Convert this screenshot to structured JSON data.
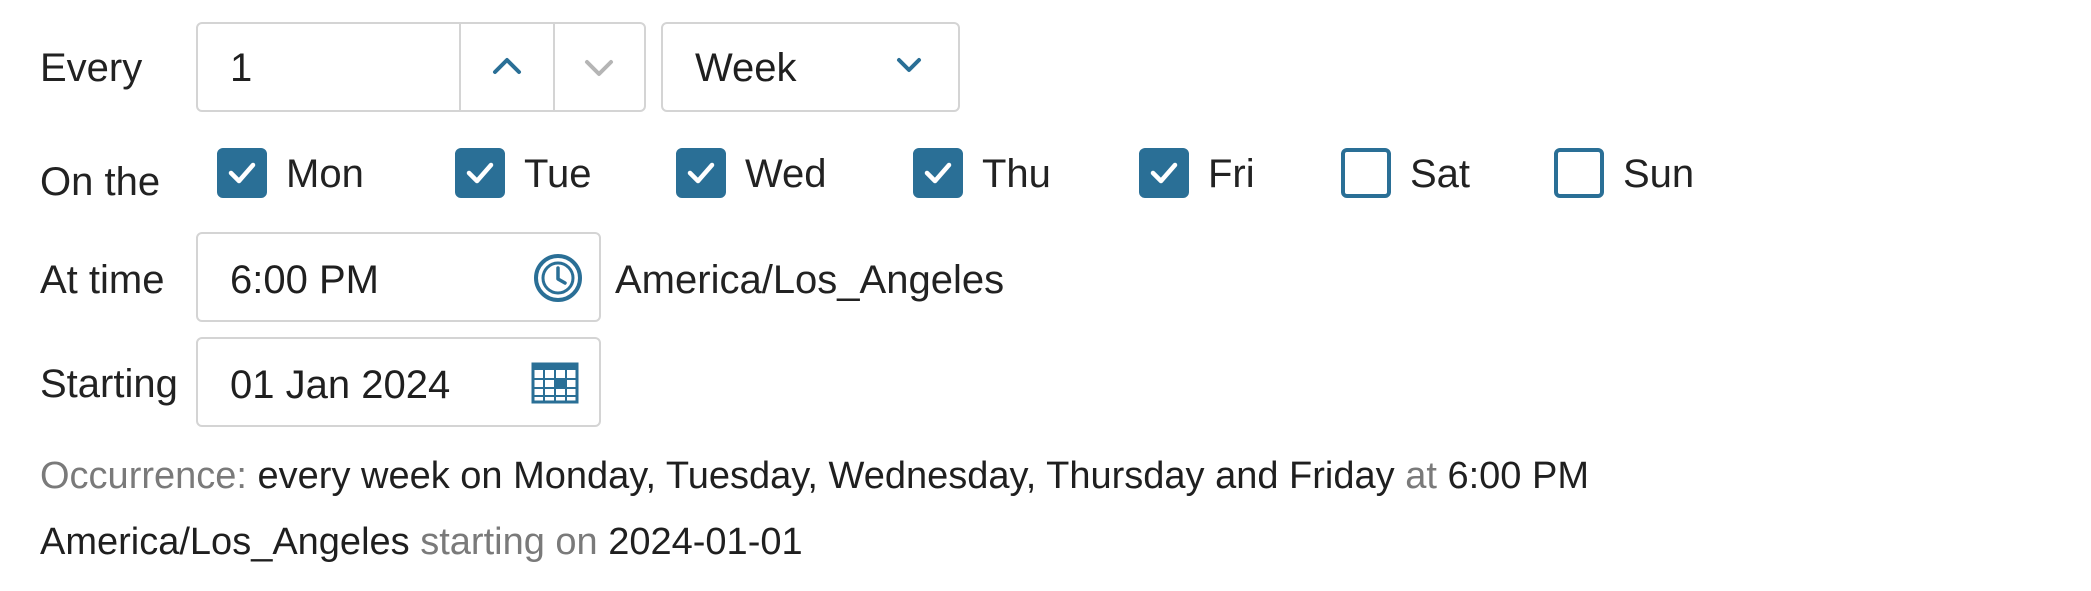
{
  "every": {
    "label": "Every",
    "value": "1",
    "unit": "Week",
    "up_icon": "chevron-up-icon",
    "down_icon": "chevron-down-icon",
    "unit_icon": "chevron-down-icon"
  },
  "on_the": {
    "label": "On the",
    "days": [
      {
        "label": "Mon",
        "checked": true
      },
      {
        "label": "Tue",
        "checked": true
      },
      {
        "label": "Wed",
        "checked": true
      },
      {
        "label": "Thu",
        "checked": true
      },
      {
        "label": "Fri",
        "checked": true
      },
      {
        "label": "Sat",
        "checked": false
      },
      {
        "label": "Sun",
        "checked": false
      }
    ]
  },
  "at_time": {
    "label": "At time",
    "value": "6:00 PM",
    "timezone": "America/Los_Angeles",
    "icon": "clock-icon"
  },
  "starting": {
    "label": "Starting",
    "value": "01 Jan 2024",
    "icon": "calendar-icon"
  },
  "summary": {
    "occurrence_label": "Occurrence:",
    "frequency": "every week on Monday, Tuesday, Wednesday, Thursday and Friday",
    "at_word": "at",
    "time": "6:00 PM",
    "timezone": "America/Los_Angeles",
    "starting_on_word": "starting on",
    "date": "2024-01-01"
  },
  "colors": {
    "accent": "#2a6f96",
    "border": "#d4d4d4",
    "muted_text": "#7a7a7a"
  }
}
